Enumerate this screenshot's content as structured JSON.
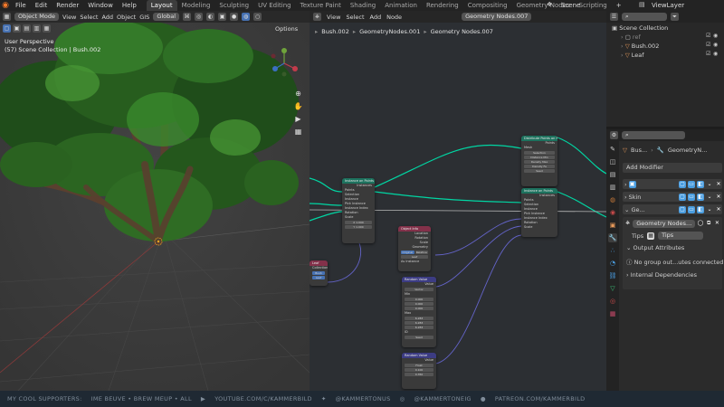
{
  "menu": {
    "items": [
      "File",
      "Edit",
      "Render",
      "Window",
      "Help"
    ],
    "workspaces": [
      "Layout",
      "Modeling",
      "Sculpting",
      "UV Editing",
      "Texture Paint",
      "Shading",
      "Animation",
      "Rendering",
      "Compositing",
      "Geometry Nodes",
      "Scripting"
    ],
    "active_workspace": "Layout",
    "add_tab": "+",
    "scene_label": "Scene",
    "viewlayer_label": "ViewLayer"
  },
  "viewport": {
    "mode": "Object Mode",
    "menus": [
      "View",
      "Select",
      "Add",
      "Object",
      "GIS"
    ],
    "orientation": "Global",
    "options_label": "Options",
    "info_line1": "User Perspective",
    "info_line2": "(57) Scene Collection | Bush.002"
  },
  "node_editor": {
    "menus": [
      "View",
      "Select",
      "Add",
      "Node"
    ],
    "tree_name": "Geometry Nodes.007",
    "breadcrumb": [
      "Bush.002",
      "GeometryNodes.001",
      "Geometry Nodes.007"
    ],
    "nodes": {
      "distribute": {
        "title": "Distribute Points",
        "rows": [
          "Geometry",
          "Density",
          "Seed"
        ]
      },
      "instance_on_points": {
        "title": "Instance on Points",
        "rows": [
          "Instances",
          "Points",
          "Selection",
          "Instance",
          "Pick Instance",
          "Instance Index",
          "Rotation",
          "Scale"
        ],
        "scale_values": [
          "X  1.000",
          "Y  1.000",
          "Z  1.000"
        ]
      },
      "distribute_top": {
        "title": "Distribute Points on Faces",
        "rows": [
          "Points",
          "Normal",
          "Rotation",
          "Mesh",
          "Selection",
          "Distance Min",
          "Density Max",
          "Density Fa",
          "Seed"
        ]
      },
      "instance_2": {
        "title": "Instance on Points",
        "rows": [
          "Instances",
          "Points",
          "Selection",
          "Instance",
          "Pick Instance",
          "Instance Index",
          "Rotation",
          "Scale"
        ]
      },
      "object_info": {
        "title": "Object Info",
        "rows": [
          "Location",
          "Rotation",
          "Scale",
          "Geometry",
          "Original",
          "Relative",
          "Leaf",
          "As Instance"
        ]
      },
      "random_rot": {
        "title": "Random Value",
        "rows": [
          "Value",
          "Vector",
          "Min",
          "Max",
          "ID",
          "Seed"
        ],
        "values": [
          "0.000",
          "0.000",
          "0.000",
          "6.283",
          "6.283",
          "6.283"
        ]
      },
      "collection": {
        "title": "Leaf",
        "rows": [
          "Collection",
          "Bush",
          "Leaf"
        ]
      },
      "random_scale": {
        "title": "Random Value",
        "rows": [
          "Value",
          "Float",
          "Min",
          "Max"
        ],
        "values": [
          "0.100",
          "0.350"
        ]
      }
    }
  },
  "outliner": {
    "title": "Scene Collection",
    "rows": [
      {
        "label": "ref",
        "indent": 1
      },
      {
        "label": "Bush.002",
        "indent": 1
      },
      {
        "label": "Leaf",
        "indent": 1
      }
    ]
  },
  "properties": {
    "bread_a": "Bus...",
    "bread_b": "GeometryN...",
    "add_modifier": "Add Modifier",
    "modifiers": [
      {
        "label": "",
        "color": "#4a9de0"
      },
      {
        "label": "Skin",
        "color": "#4a9de0"
      },
      {
        "label": "Ge...",
        "color": "#4a9de0"
      }
    ],
    "node_group": "Geometry Nodes...",
    "tips_label": "Tips",
    "tips_value": "Tips",
    "output_attributes": "Output Attributes",
    "output_msg": "No group out...utes connected",
    "internal_deps": "Internal Dependencies"
  },
  "footer": {
    "text1": "MY COOL SUPPORTERS:",
    "text2": "IME BEUVE • BREW MEUP • ALL",
    "youtube": "YOUTUBE.COM/C/KAMMERBILD",
    "twitter": "@KAMMERTONUS",
    "instagram": "@KAMMERTONEIG",
    "patreon": "PATREON.COM/KAMMERBILD"
  },
  "colors": {
    "accent": "#4772b3",
    "geometry_wire": "#00d6a3",
    "vector_wire": "#6363c7",
    "workspace_active": "#3d3d3d"
  }
}
